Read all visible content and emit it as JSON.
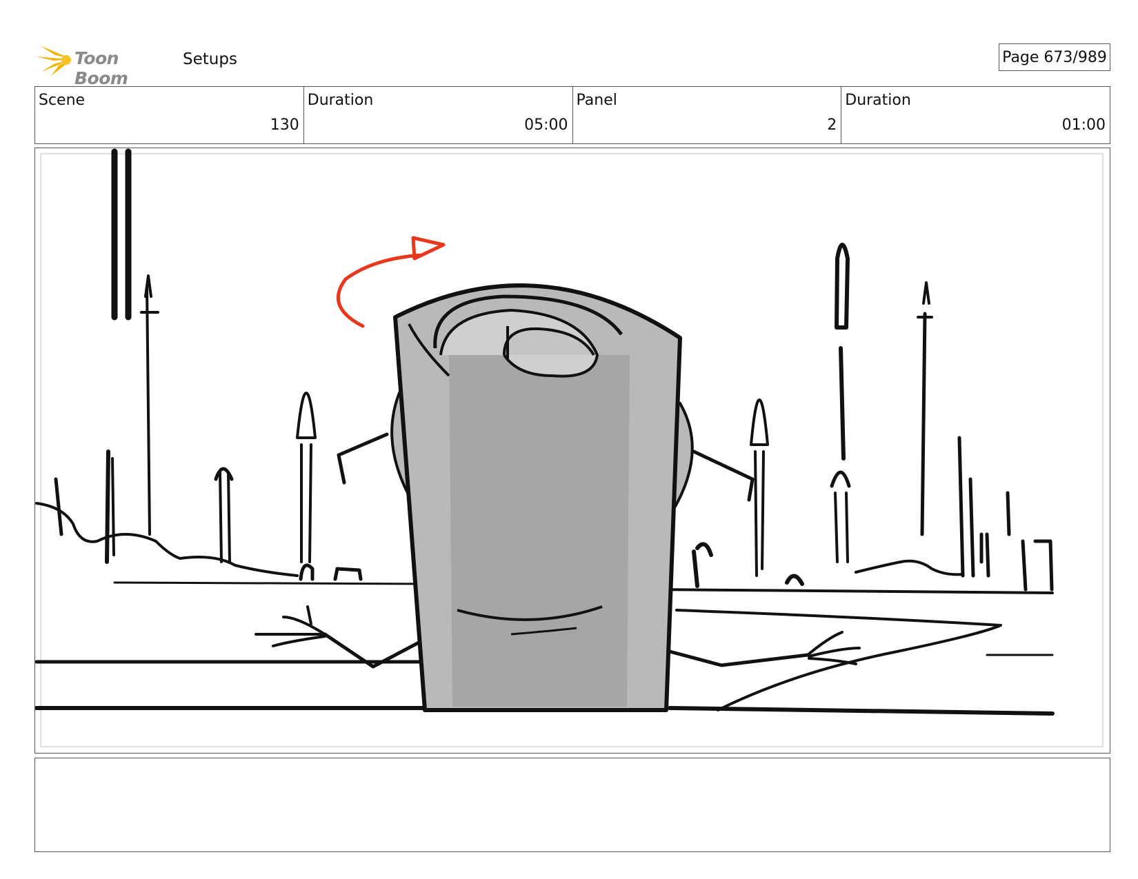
{
  "header": {
    "logo_text": "Toon Boom",
    "section_title": "Setups",
    "page_label": "Page 673/989"
  },
  "info": {
    "scene_label": "Scene",
    "scene_value": "130",
    "scene_duration_label": "Duration",
    "scene_duration_value": "05:00",
    "panel_label": "Panel",
    "panel_value": "2",
    "panel_duration_label": "Duration",
    "panel_duration_value": "01:00"
  },
  "colors": {
    "logo_yellow": "#f5b400",
    "arrow_red": "#e8371d",
    "sketch_gray": "#b9b9b9",
    "sketch_gray_dark": "#a6a6a6"
  }
}
